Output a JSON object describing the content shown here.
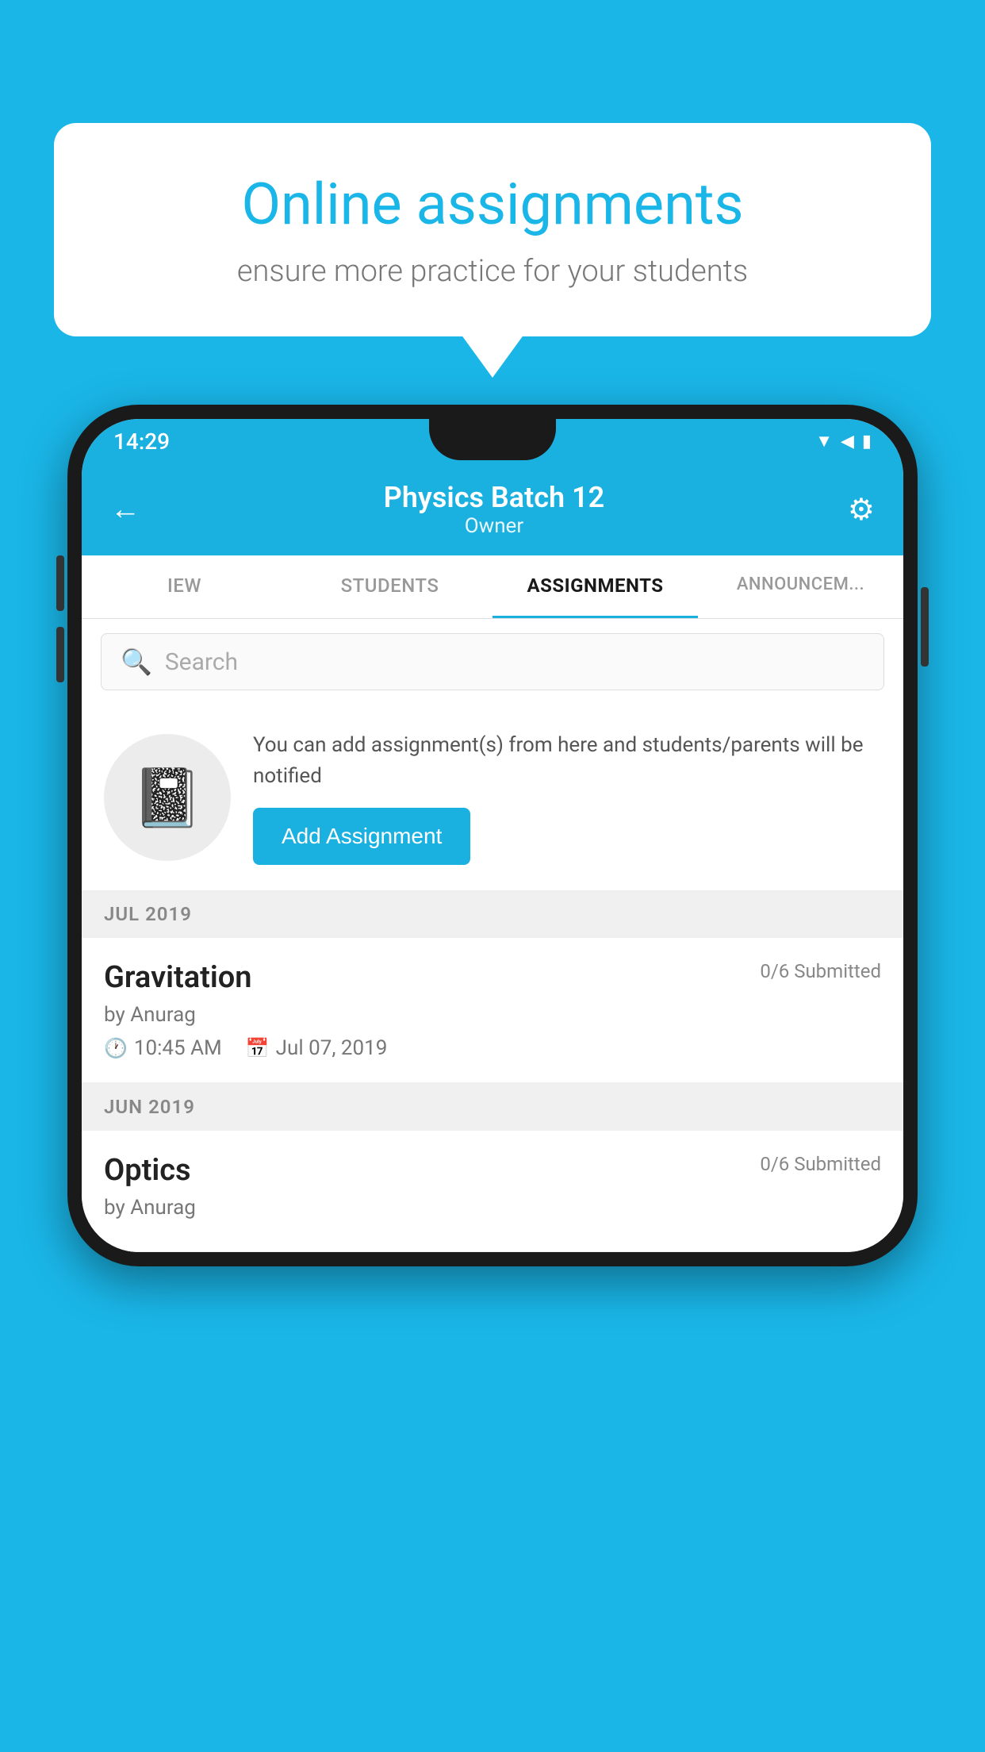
{
  "background": {
    "color": "#1ab6e8"
  },
  "speech_bubble": {
    "title": "Online assignments",
    "subtitle": "ensure more practice for your students"
  },
  "status_bar": {
    "time": "14:29",
    "icons": [
      "wifi",
      "signal",
      "battery"
    ]
  },
  "header": {
    "back_label": "←",
    "title": "Physics Batch 12",
    "subtitle": "Owner",
    "gear_label": "⚙"
  },
  "tabs": [
    {
      "label": "IEW",
      "active": false
    },
    {
      "label": "STUDENTS",
      "active": false
    },
    {
      "label": "ASSIGNMENTS",
      "active": true
    },
    {
      "label": "ANNOUNCEM...",
      "active": false
    }
  ],
  "search": {
    "placeholder": "Search"
  },
  "add_assignment": {
    "description": "You can add assignment(s) from here and students/parents will be notified",
    "button_label": "Add Assignment"
  },
  "sections": [
    {
      "title": "JUL 2019",
      "assignments": [
        {
          "name": "Gravitation",
          "submitted": "0/6 Submitted",
          "author": "by Anurag",
          "time": "10:45 AM",
          "date": "Jul 07, 2019"
        }
      ]
    },
    {
      "title": "JUN 2019",
      "assignments": [
        {
          "name": "Optics",
          "submitted": "0/6 Submitted",
          "author": "by Anurag",
          "time": "",
          "date": ""
        }
      ]
    }
  ]
}
